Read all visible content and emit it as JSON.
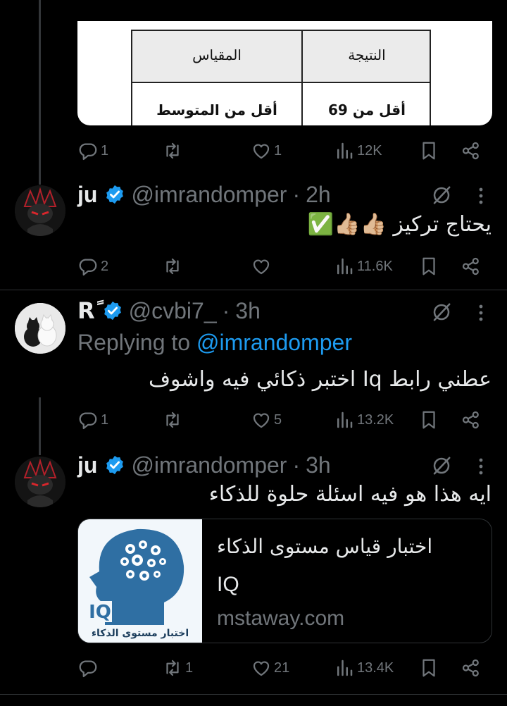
{
  "image_tweet": {
    "table": {
      "header_result": "النتيجة",
      "header_scale": "المقياس",
      "row_result": "أقل من 69",
      "row_scale": "أقل من المتوسط"
    },
    "actions": {
      "replies": "1",
      "retweets": "",
      "likes": "1",
      "views": "12K"
    }
  },
  "tweet1": {
    "name": "ju",
    "handle": "@imrandomper",
    "dot": "·",
    "time": "2h",
    "text": "يحتاج تركيز 👍🏼👍🏼✅",
    "actions": {
      "replies": "2",
      "retweets": "",
      "likes": "",
      "views": "11.6K"
    }
  },
  "tweet2": {
    "name": "Rً",
    "handle": "@cvbi7_",
    "dot": "·",
    "time": "3h",
    "replying_prefix": "Replying to ",
    "replying_to": "@imrandomper",
    "text": "عطني رابط Iq اختبر ذكائي فيه واشوف",
    "actions": {
      "replies": "1",
      "retweets": "",
      "likes": "5",
      "views": "13.2K"
    }
  },
  "tweet3": {
    "name": "ju",
    "handle": "@imrandomper",
    "dot": "·",
    "time": "3h",
    "text": "ايه هذا هو فيه اسئلة حلوة للذكاء",
    "card": {
      "title": "اختبار قياس مستوى الذكاء",
      "subtitle": "IQ",
      "domain": "mstaway.com",
      "thumb_iq": "IQ",
      "thumb_caption": "اختبار مستوى الذكاء"
    },
    "actions": {
      "replies": "",
      "retweets": "1",
      "likes": "21",
      "views": "13.4K"
    }
  },
  "colors": {
    "accent": "#1d9bf0",
    "muted": "#71767b",
    "divider": "#2f3336",
    "thumb_blue": "#2f6fa3"
  }
}
